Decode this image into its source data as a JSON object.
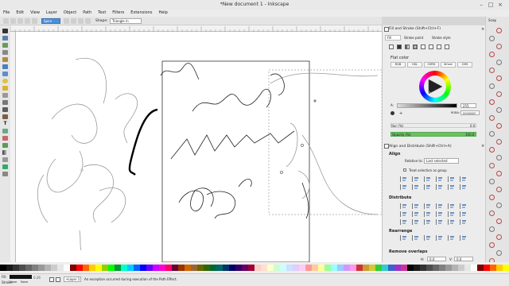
{
  "window": {
    "title": "*New document 1 - Inkscape"
  },
  "menu": [
    "File",
    "Edit",
    "View",
    "Layer",
    "Object",
    "Path",
    "Text",
    "Filters",
    "Extensions",
    "Help"
  ],
  "commandbar": {
    "mode_value": "Spiro",
    "shape_label": "Shape:",
    "shape_value": "Triangle in"
  },
  "fill_stroke": {
    "title": "Fill and Stroke (Shift+Ctrl+F)",
    "tabs": [
      "Fill",
      "Stroke paint",
      "Stroke style"
    ],
    "flat_color_label": "Flat color",
    "color_modes": [
      "RGB",
      "HSL",
      "CMYK",
      "Wheel",
      "CMS"
    ],
    "alpha_label": "A:",
    "alpha_value": "255",
    "rgba_label": "RGBA:",
    "rgba_value": "000000ff",
    "blur_label": "Blur (%)",
    "blur_value": "0.0",
    "opacity_label": "Opacity (%)",
    "opacity_value": "100.0"
  },
  "align": {
    "title": "Align and Distribute (Shift+Ctrl+A)",
    "align_label": "Align",
    "relative_label": "Relative to:",
    "relative_value": "Last selected",
    "treat_label": "Treat selection as group",
    "distribute_label": "Distribute",
    "rearrange_label": "Rearrange",
    "remove_overlaps_label": "Remove overlaps",
    "h_label": "H:",
    "h_value": "0.0",
    "v_label": "V:",
    "v_value": "0.0"
  },
  "right_bar": {
    "snap_label": "Snap"
  },
  "status": {
    "fill_label": "Fill:",
    "stroke_label": "Stroke:",
    "fill_value": "None",
    "stroke_value": "None",
    "width_value": "0.26",
    "layer": "•Layer 1",
    "message": "An exception occurred during execution of the Path Effect."
  },
  "colors": {
    "accent": "#4a90d9",
    "path_stroke": "#111111",
    "palette_bg": "#eeeeee"
  },
  "icons": [
    "selector-icon",
    "node-icon",
    "tweak-icon",
    "zoom-icon",
    "measure-icon",
    "rect-icon",
    "3dbox-icon",
    "ellipse-icon",
    "star-icon",
    "spiral-icon",
    "pencil-icon",
    "pen-icon",
    "calligraphy-icon",
    "text-icon",
    "spray-icon",
    "eraser-icon",
    "bucket-icon",
    "gradient-icon",
    "mesh-icon",
    "dropper-icon",
    "connector-icon"
  ]
}
